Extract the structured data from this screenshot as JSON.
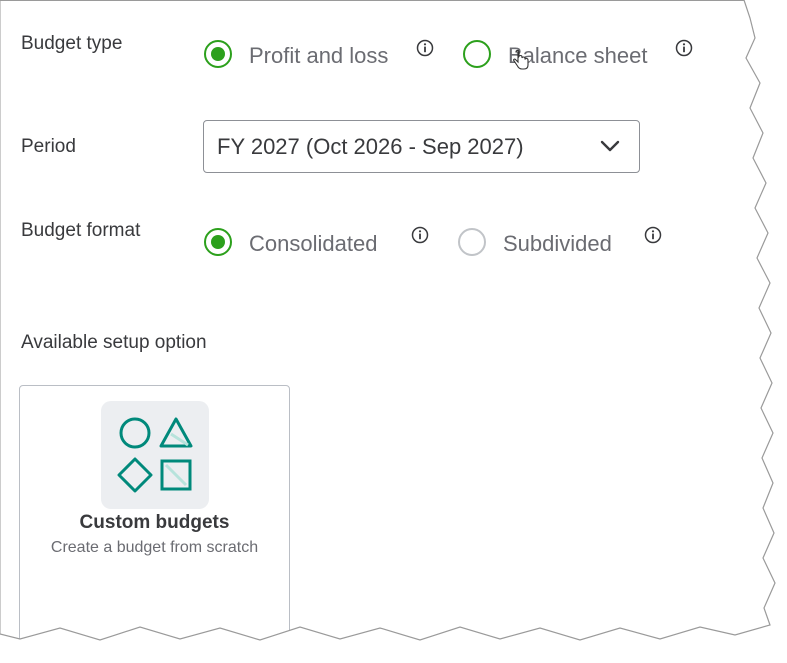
{
  "budget_type": {
    "label": "Budget type",
    "options": [
      {
        "label": "Profit and loss",
        "selected": true
      },
      {
        "label": "Balance sheet",
        "selected": false
      }
    ]
  },
  "period": {
    "label": "Period",
    "value": "FY 2027 (Oct 2026 - Sep 2027)"
  },
  "budget_format": {
    "label": "Budget format",
    "options": [
      {
        "label": "Consolidated",
        "selected": true
      },
      {
        "label": "Subdivided",
        "selected": false
      }
    ]
  },
  "setup": {
    "heading": "Available setup option",
    "cards": [
      {
        "title": "Custom budgets",
        "description": "Create a budget from scratch",
        "icon": "shapes-icon"
      }
    ]
  },
  "colors": {
    "accent_green": "#2ca01c",
    "icon_teal": "#00897b",
    "text_dark": "#393a3d",
    "text_muted": "#6b6c72"
  }
}
